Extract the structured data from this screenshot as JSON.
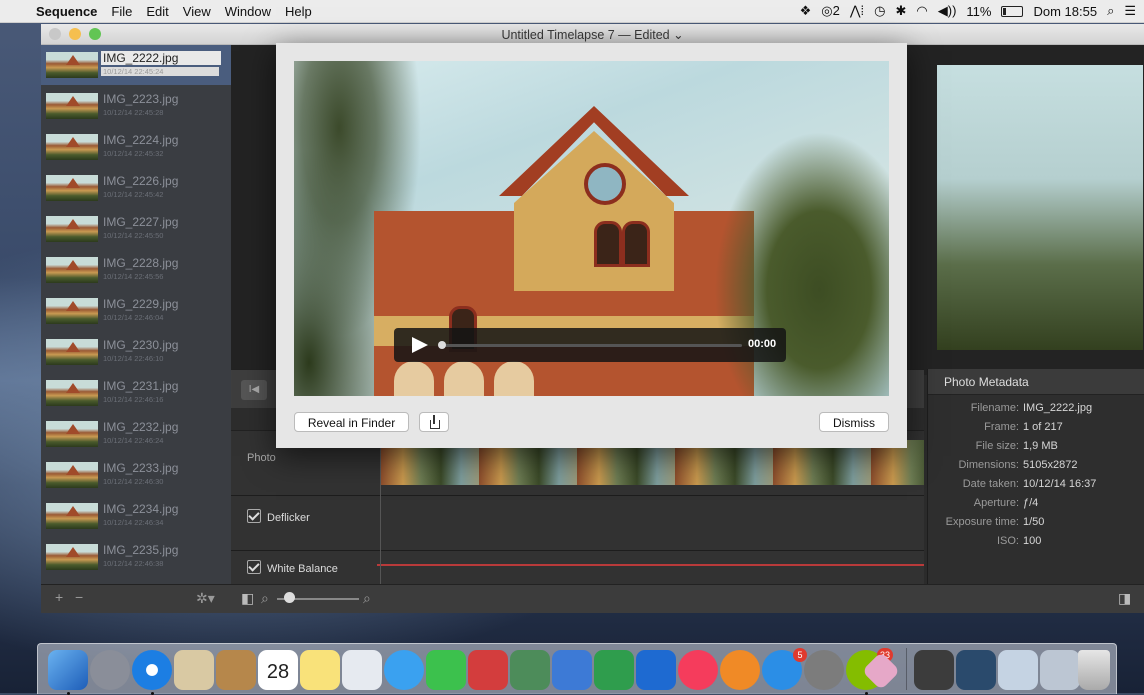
{
  "menubar": {
    "app_name": "Sequence",
    "items": [
      "File",
      "Edit",
      "View",
      "Window",
      "Help"
    ],
    "status": {
      "notifications": "2",
      "battery": "11%",
      "clock": "Dom 18:55"
    }
  },
  "window": {
    "title": "Untitled Timelapse 7 — Edited ⌄"
  },
  "sidebar": {
    "frames": [
      {
        "name": "IMG_2222.jpg",
        "date": "10/12/14 22:45:24",
        "selected": true
      },
      {
        "name": "IMG_2223.jpg",
        "date": "10/12/14 22:45:28"
      },
      {
        "name": "IMG_2224.jpg",
        "date": "10/12/14 22:45:32"
      },
      {
        "name": "IMG_2226.jpg",
        "date": "10/12/14 22:45:42"
      },
      {
        "name": "IMG_2227.jpg",
        "date": "10/12/14 22:45:50"
      },
      {
        "name": "IMG_2228.jpg",
        "date": "10/12/14 22:45:56"
      },
      {
        "name": "IMG_2229.jpg",
        "date": "10/12/14 22:46:04"
      },
      {
        "name": "IMG_2230.jpg",
        "date": "10/12/14 22:46:10"
      },
      {
        "name": "IMG_2231.jpg",
        "date": "10/12/14 22:46:16"
      },
      {
        "name": "IMG_2232.jpg",
        "date": "10/12/14 22:46:24"
      },
      {
        "name": "IMG_2233.jpg",
        "date": "10/12/14 22:46:30"
      },
      {
        "name": "IMG_2234.jpg",
        "date": "10/12/14 22:46:34"
      },
      {
        "name": "IMG_2235.jpg",
        "date": "10/12/14 22:46:38"
      }
    ]
  },
  "tracks": {
    "photos_label": "Photo",
    "deflicker_label": "Deflicker",
    "white_balance_label": "White Balance"
  },
  "metadata": {
    "title": "Photo Metadata",
    "rows": [
      {
        "key": "Filename:",
        "value": "IMG_2222.jpg"
      },
      {
        "key": "Frame:",
        "value": "1 of 217"
      },
      {
        "key": "File size:",
        "value": "1,9 MB"
      },
      {
        "key": "Dimensions:",
        "value": "5105x2872"
      },
      {
        "key": "Date taken:",
        "value": "10/12/14 16:37"
      },
      {
        "key": "Aperture:",
        "value": "ƒ/4"
      },
      {
        "key": "Exposure time:",
        "value": "1/50"
      },
      {
        "key": "ISO:",
        "value": "100"
      }
    ]
  },
  "modal": {
    "player_time": "00:00",
    "reveal_label": "Reveal in Finder",
    "dismiss_label": "Dismiss"
  },
  "dock": {
    "calendar_day": "28",
    "badges": {
      "app_store": "5",
      "spotify": "33"
    }
  }
}
